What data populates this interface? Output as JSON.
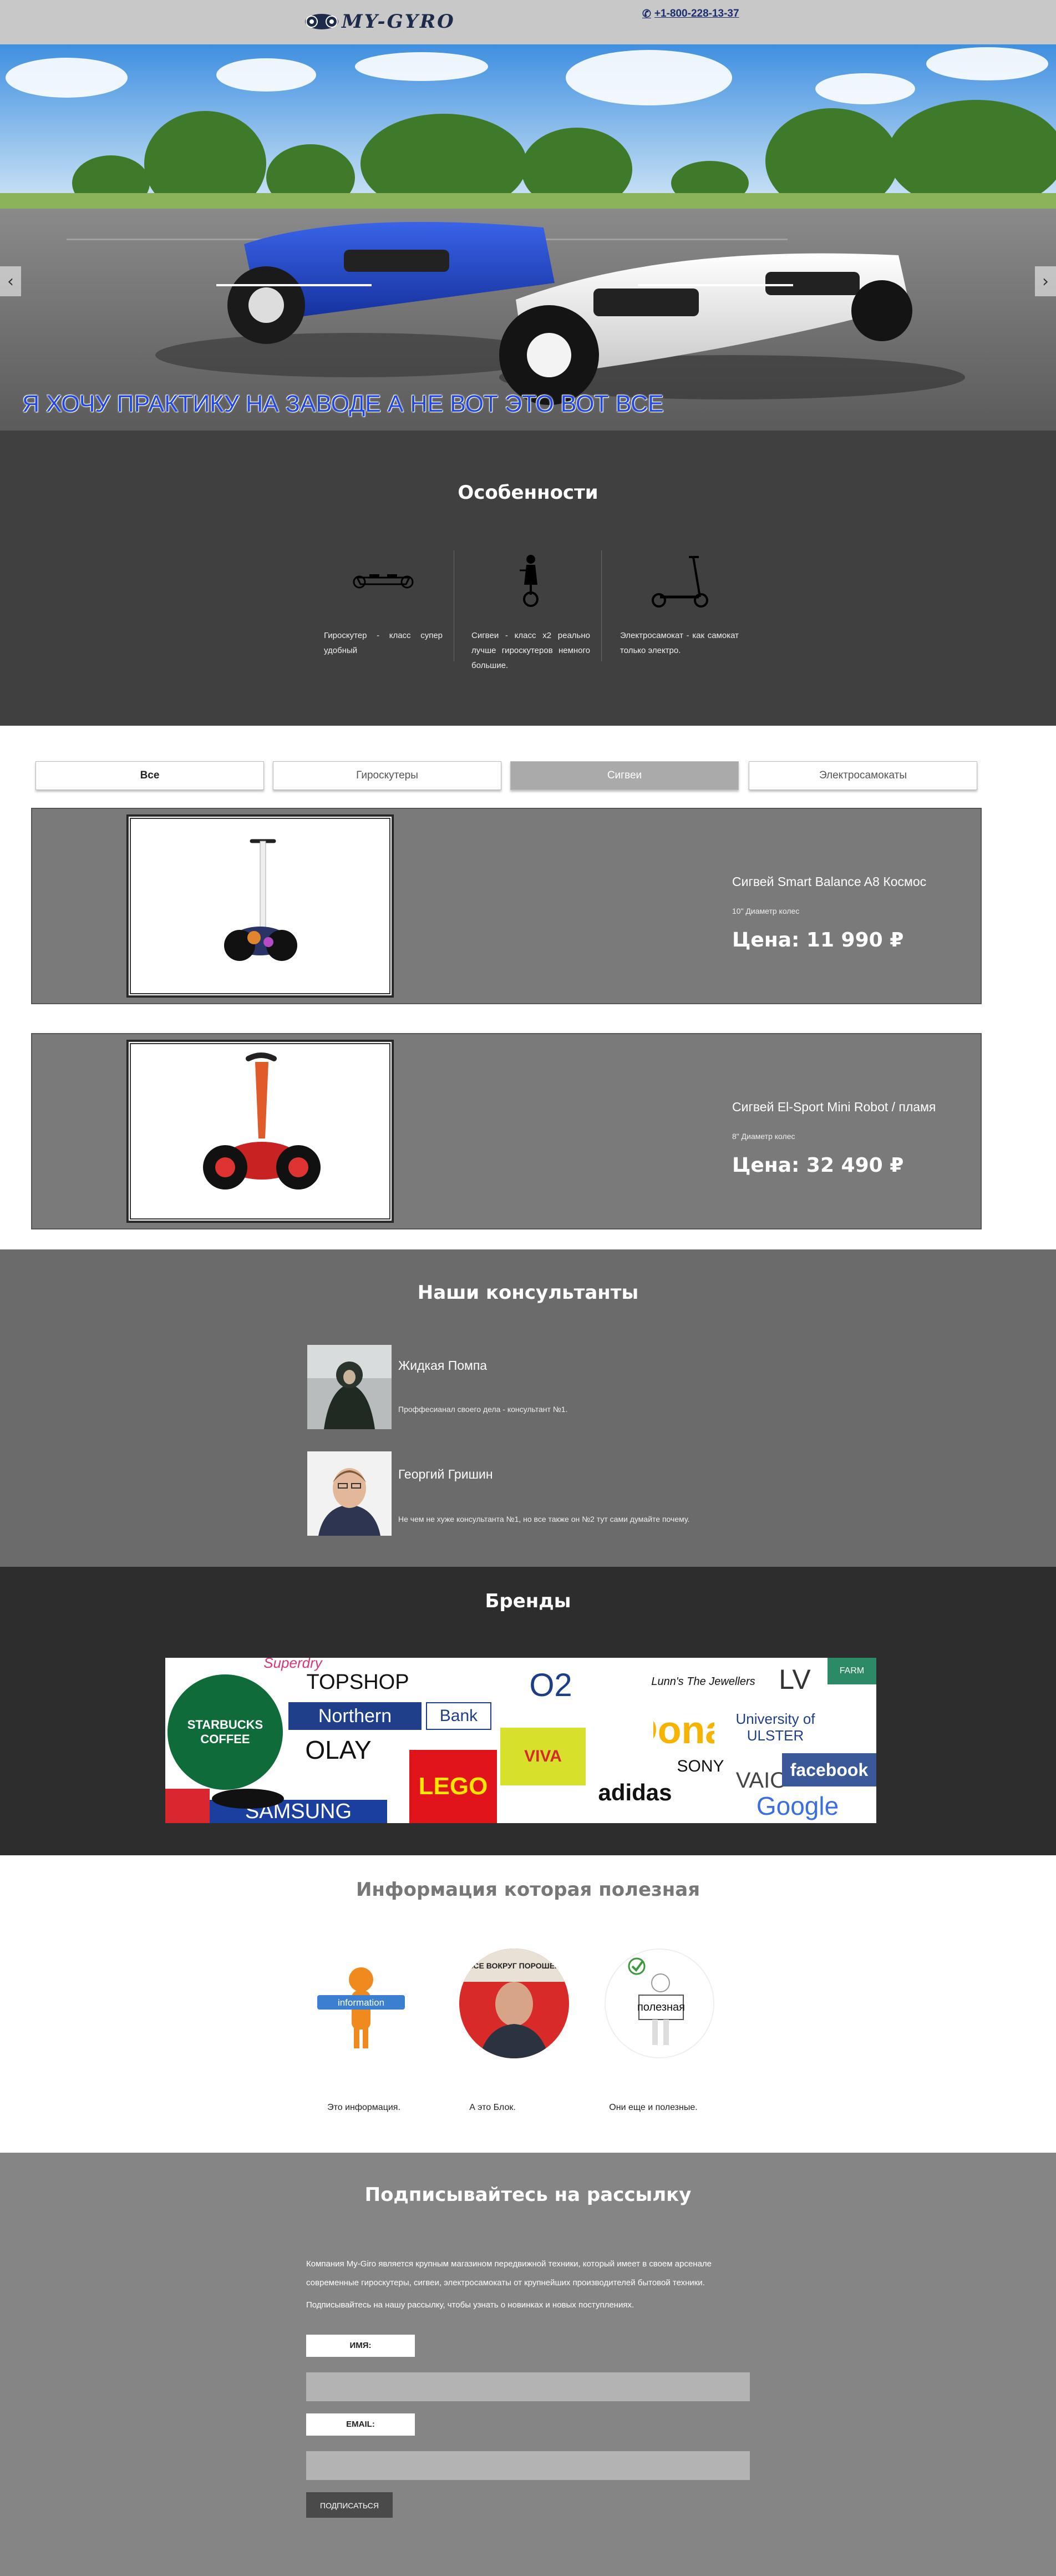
{
  "header": {
    "logo_text": "MY-GYRO",
    "phone": "+1-800-228-13-37",
    "phone_icon": "phone-icon"
  },
  "hero": {
    "caption": "Я ХОЧУ ПРАКТИКУ НА ЗАВОДЕ А НЕ ВОТ ЭТО ВОТ ВСЕ",
    "prev_icon": "chevron-left-icon",
    "next_icon": "chevron-right-icon"
  },
  "features": {
    "title": "Особенности",
    "items": [
      {
        "icon": "hoverboard-icon",
        "text": "Гироскутер - класс супер удобный"
      },
      {
        "icon": "segway-icon",
        "text": "Сигвеи - класс x2 реально лучше гироскутеров немного большие."
      },
      {
        "icon": "scooter-icon",
        "text": "Электросамокат - как самокат только электро."
      }
    ]
  },
  "tabs": [
    {
      "label": "Все"
    },
    {
      "label": "Гироскутеры"
    },
    {
      "label": "Сигвеи"
    },
    {
      "label": "Электросамокаты"
    }
  ],
  "products": [
    {
      "name": "Сигвей Smart Balance A8 Космос",
      "spec": "10\" Диаметр колес",
      "price": "Цена: 11 990 ₽"
    },
    {
      "name": "Сигвей El-Sport Mini Robot / пламя",
      "spec": "8\" Диаметр колес",
      "price": "Цена: 32 490 ₽"
    }
  ],
  "consultants": {
    "title": "Наши консультанты",
    "items": [
      {
        "name": "Жидкая Помпа",
        "desc": "Проффесианал своего дела - консультант №1."
      },
      {
        "name": "Георгий Гришин",
        "desc": "Не чем не хуже консультанта №1, но все также он №2 тут сами думайте почему."
      }
    ]
  },
  "brands": {
    "title": "Бренды",
    "logos": [
      "Superdry",
      "TOPSHOP",
      "O2",
      "Lunn's The Jewellers",
      "LV",
      "FARM",
      "STARBUCKS COFFEE",
      "Northern",
      "Bank",
      "University of ULSTER",
      "OLAY",
      "LEGO",
      "VIVA",
      "McDonald's",
      "SONY",
      "VAIO",
      "facebook",
      "adidas",
      "SAMSUNG",
      "Google"
    ]
  },
  "info": {
    "title": "Информация которая полезная",
    "items": [
      {
        "caption": "Это информация.",
        "sign": "information"
      },
      {
        "caption": "А это Блок.",
        "sign": "ВСЕ ВОКРУГ ПОРОШЕН"
      },
      {
        "caption": "Они еще и полезные.",
        "sign": "полезная"
      }
    ]
  },
  "subscribe": {
    "title": "Подписывайтесь на рассылку",
    "para1": "Компания My-Giro является крупным магазином передвижной техники, который имеет в своем арсенале современные гироскутеры, сигвеи, электросамокаты от крупнейших производителей бытовой техники.",
    "para2": "Подписывайтесь на нашу рассылку, чтобы узнать о новинках и новых поступлениях.",
    "name_label": "ИМЯ:",
    "email_label": "EMAIL:",
    "button": "ПОДПИСАТЬСЯ"
  },
  "colors": {
    "header_bg": "#c8c8c8",
    "features_bg": "#404040",
    "products_bg": "#7a7a7a",
    "consultants_bg": "#6b6b6b",
    "brands_bg": "#2d2d2d",
    "subscribe_bg": "#858585",
    "hero_caption": "#2549e0"
  }
}
